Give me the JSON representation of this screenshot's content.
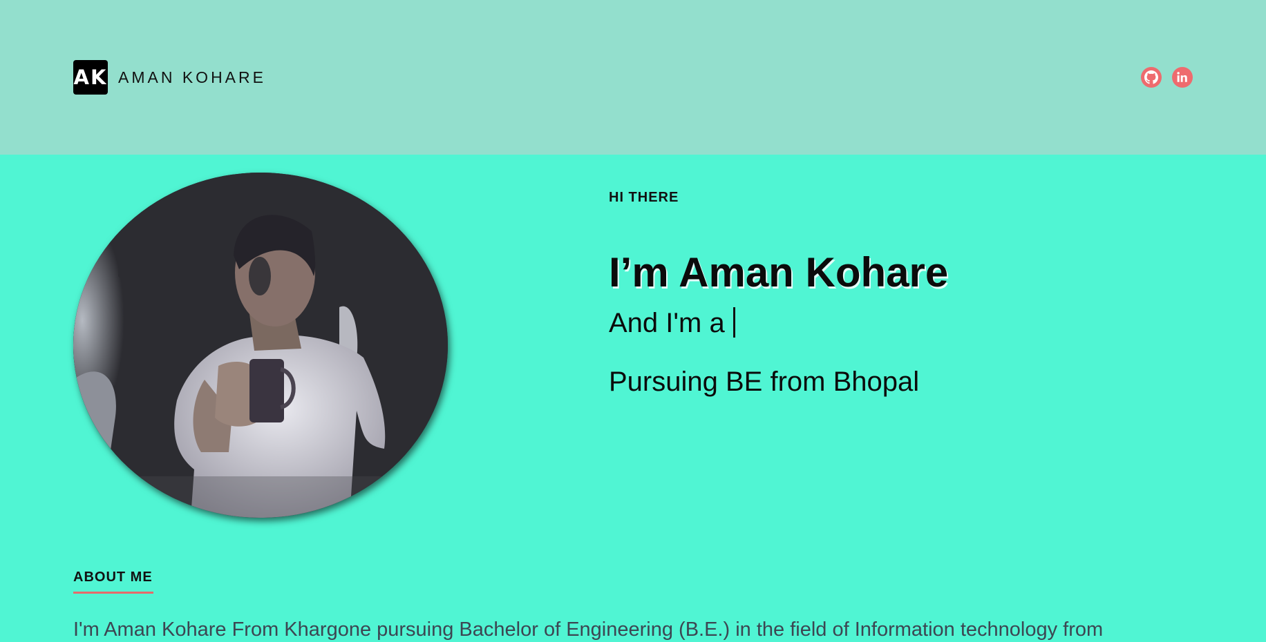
{
  "header": {
    "logo_text": "AK",
    "brand_name": "AMAN KOHARE",
    "bg_color": "#93dfcd",
    "socials": [
      {
        "icon": "github-icon"
      },
      {
        "icon": "linkedin-icon"
      }
    ],
    "social_color": "#ee6b6e"
  },
  "hero": {
    "greeting": "HI THERE",
    "title": "I’m Aman Kohare",
    "typing_prefix": "And I'm a",
    "subtitle": "Pursuing BE from Bhopal",
    "bg_color": "#50f5d3"
  },
  "about": {
    "heading": "ABOUT ME",
    "text": "I'm Aman Kohare From Khargone pursuing Bachelor of Engineering (B.E.) in the field of Information technology from",
    "underline_color": "#e56b6b"
  }
}
